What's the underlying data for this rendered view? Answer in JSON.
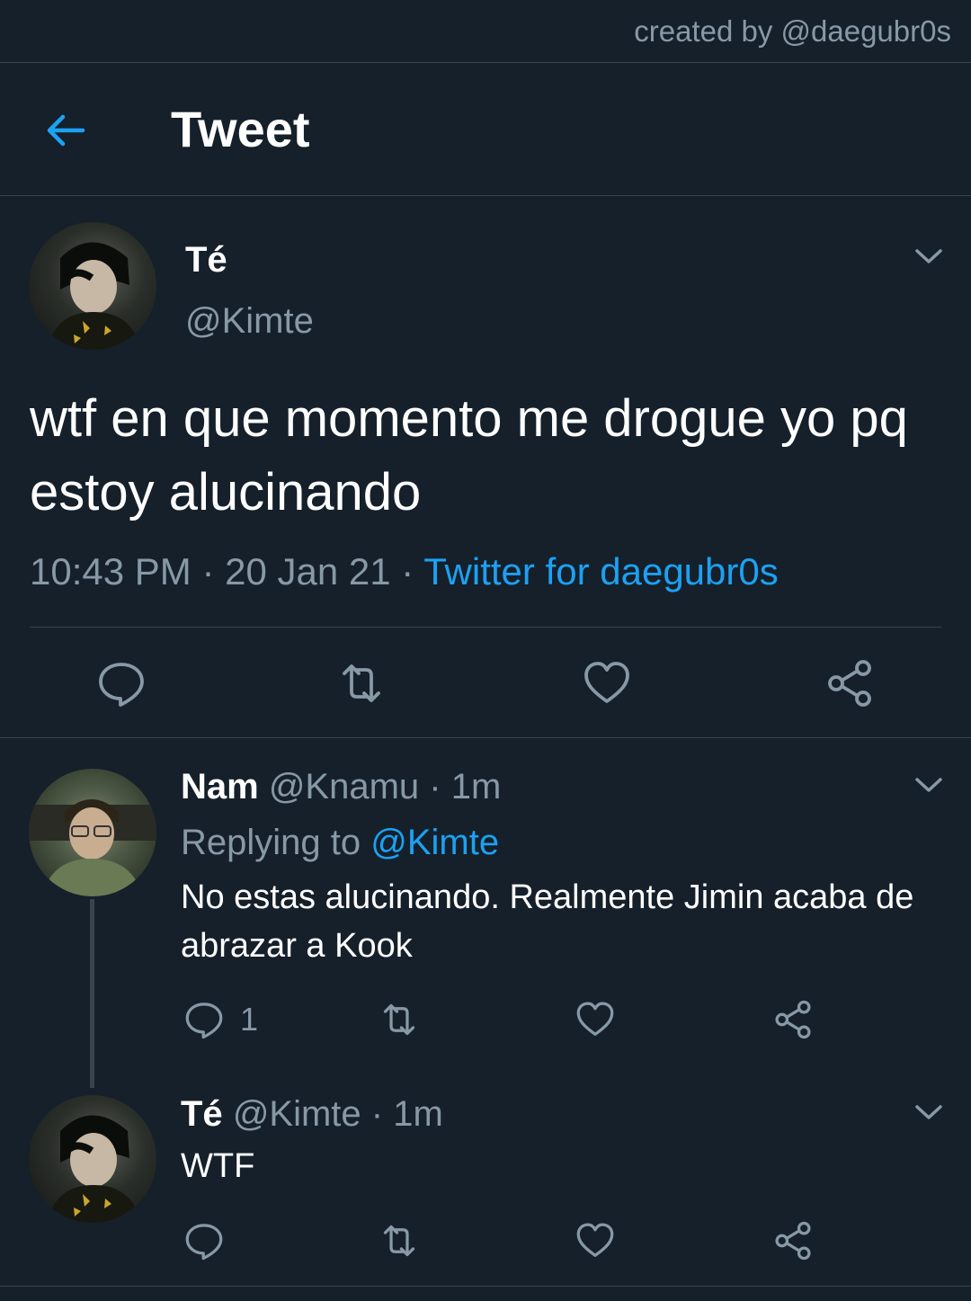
{
  "credit": "created by @daegubr0s",
  "header": {
    "title": "Tweet",
    "back_icon": "back-arrow-icon"
  },
  "main_tweet": {
    "name": "Té",
    "handle": "@Kimte",
    "text": "wtf en que momento me drogue yo pq estoy alucinando",
    "time": "10:43 PM",
    "date": "20 Jan 21",
    "separator": "·",
    "source": "Twitter for daegubr0s",
    "actions": [
      "reply-icon",
      "retweet-icon",
      "like-icon",
      "share-icon"
    ]
  },
  "replies": [
    {
      "name": "Nam",
      "handle": "@Knamu",
      "time": "1m",
      "replying_label": "Replying to",
      "replying_to": "@Kimte",
      "text": "No estas alucinando. Realmente Jimin acaba de abrazar a Kook",
      "reply_count": "1"
    },
    {
      "name": "Té",
      "handle": "@Kimte",
      "time": "1m",
      "text": "WTF"
    }
  ],
  "colors": {
    "background": "#15202b",
    "accent": "#1da1f2",
    "muted_text": "#8899a6",
    "divider": "#38444d"
  }
}
